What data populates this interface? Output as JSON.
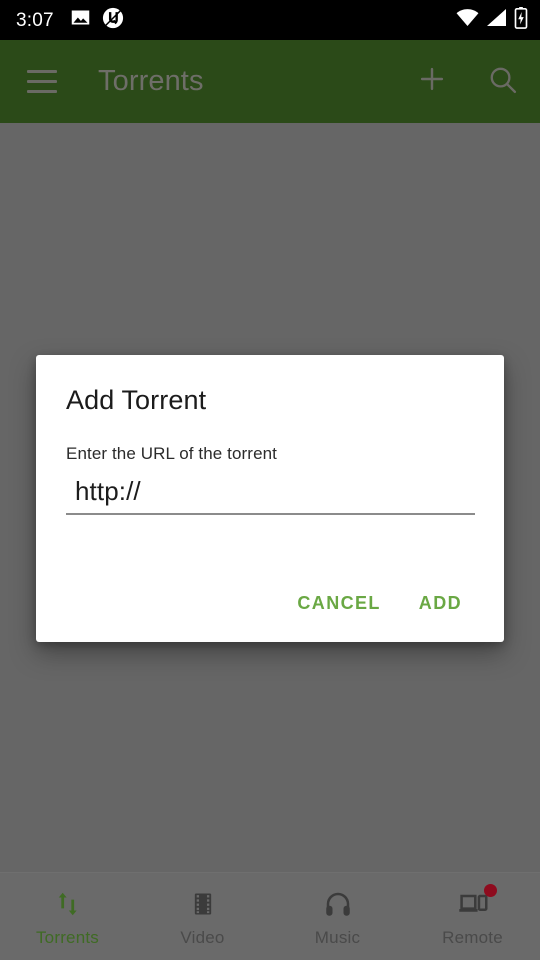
{
  "status_bar": {
    "clock": "3:07",
    "left_icons": [
      "image-icon",
      "utorrent-icon"
    ],
    "right_icons": [
      "wifi-icon",
      "cell-signal-icon",
      "battery-charging-icon"
    ],
    "background": "#000000"
  },
  "app_bar": {
    "title": "Torrents",
    "menu_icon": "hamburger-menu-icon",
    "actions": [
      {
        "name": "add-torrent-button",
        "icon": "plus-icon"
      },
      {
        "name": "search-button",
        "icon": "search-icon"
      }
    ],
    "background": "#2b4a18"
  },
  "dialog": {
    "title": "Add Torrent",
    "message": "Enter the URL of the torrent",
    "input": {
      "value": "http://",
      "placeholder": "http://"
    },
    "cancel_label": "CANCEL",
    "confirm_label": "ADD",
    "accent_color": "#6aa844",
    "background": "#ffffff"
  },
  "scrim": {
    "color": "#666666"
  },
  "bottom_nav": {
    "items": [
      {
        "label": "Torrents",
        "icon": "transfer-arrows-icon",
        "active": true,
        "badge": false
      },
      {
        "label": "Video",
        "icon": "film-strip-icon",
        "active": false,
        "badge": false
      },
      {
        "label": "Music",
        "icon": "headphones-icon",
        "active": false,
        "badge": false
      },
      {
        "label": "Remote",
        "icon": "devices-icon",
        "active": false,
        "badge": true
      }
    ],
    "active_color": "#3f6b24",
    "inactive_color": "#4a4a4a",
    "badge_color": "#8e0b1e"
  }
}
